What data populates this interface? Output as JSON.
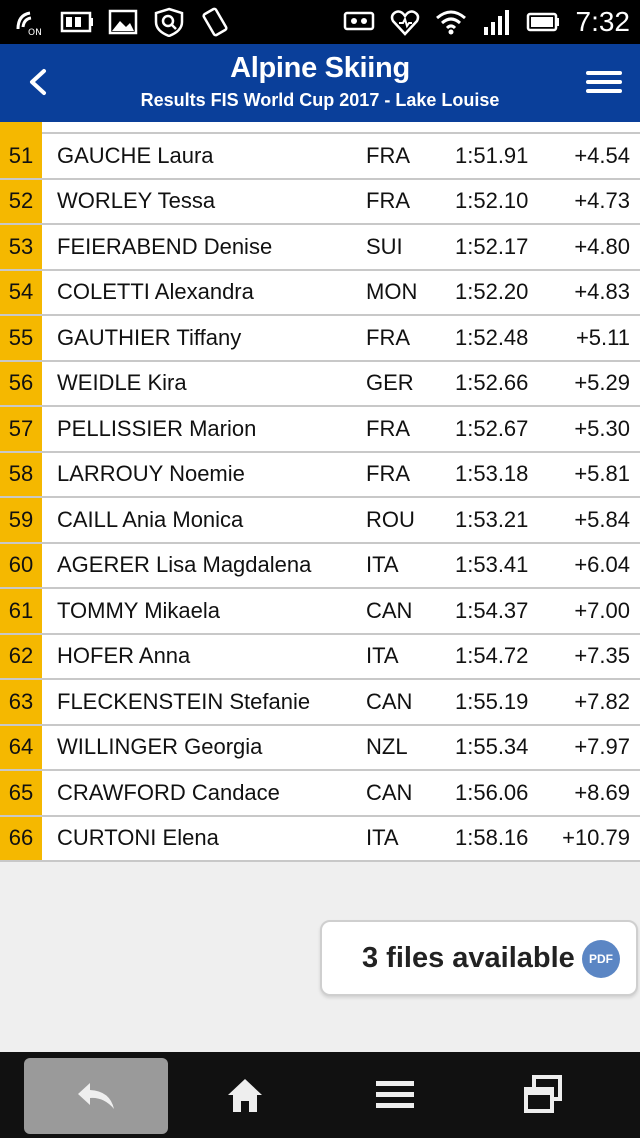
{
  "status_bar": {
    "time": "7:32",
    "left_icons": [
      "nfc-on-icon",
      "battery-saver-icon",
      "image-icon",
      "shield-search-icon",
      "rotate-icon"
    ],
    "right_icons": [
      "cast-icon",
      "heart-sync-icon",
      "wifi-icon",
      "signal-icon",
      "battery-icon"
    ],
    "nfc_label": "ON"
  },
  "header": {
    "title": "Alpine Skiing",
    "subtitle": "Results FIS World Cup 2017 - Lake Louise",
    "background": "#0a3f9a"
  },
  "results": {
    "accent_color": "#f5b800",
    "rows": [
      {
        "rank": "51",
        "name": "GAUCHE Laura",
        "nation": "FRA",
        "time": "1:51.91",
        "diff": "+4.54"
      },
      {
        "rank": "52",
        "name": "WORLEY Tessa",
        "nation": "FRA",
        "time": "1:52.10",
        "diff": "+4.73"
      },
      {
        "rank": "53",
        "name": "FEIERABEND Denise",
        "nation": "SUI",
        "time": "1:52.17",
        "diff": "+4.80"
      },
      {
        "rank": "54",
        "name": "COLETTI Alexandra",
        "nation": "MON",
        "time": "1:52.20",
        "diff": "+4.83"
      },
      {
        "rank": "55",
        "name": "GAUTHIER Tiffany",
        "nation": "FRA",
        "time": "1:52.48",
        "diff": "+5.11"
      },
      {
        "rank": "56",
        "name": "WEIDLE Kira",
        "nation": "GER",
        "time": "1:52.66",
        "diff": "+5.29"
      },
      {
        "rank": "57",
        "name": "PELLISSIER Marion",
        "nation": "FRA",
        "time": "1:52.67",
        "diff": "+5.30"
      },
      {
        "rank": "58",
        "name": "LARROUY Noemie",
        "nation": "FRA",
        "time": "1:53.18",
        "diff": "+5.81"
      },
      {
        "rank": "59",
        "name": "CAILL Ania Monica",
        "nation": "ROU",
        "time": "1:53.21",
        "diff": "+5.84"
      },
      {
        "rank": "60",
        "name": "AGERER Lisa Magdalena",
        "nation": "ITA",
        "time": "1:53.41",
        "diff": "+6.04"
      },
      {
        "rank": "61",
        "name": "TOMMY Mikaela",
        "nation": "CAN",
        "time": "1:54.37",
        "diff": "+7.00"
      },
      {
        "rank": "62",
        "name": "HOFER Anna",
        "nation": "ITA",
        "time": "1:54.72",
        "diff": "+7.35"
      },
      {
        "rank": "63",
        "name": "FLECKENSTEIN Stefanie",
        "nation": "CAN",
        "time": "1:55.19",
        "diff": "+7.82"
      },
      {
        "rank": "64",
        "name": "WILLINGER Georgia",
        "nation": "NZL",
        "time": "1:55.34",
        "diff": "+7.97"
      },
      {
        "rank": "65",
        "name": "CRAWFORD Candace",
        "nation": "CAN",
        "time": "1:56.06",
        "diff": "+8.69"
      },
      {
        "rank": "66",
        "name": "CURTONI Elena",
        "nation": "ITA",
        "time": "1:58.16",
        "diff": "+10.79"
      }
    ]
  },
  "files": {
    "label": "3 files available",
    "badge": "PDF"
  },
  "bottom_nav": {
    "items": [
      "back-icon",
      "home-icon",
      "menu-icon",
      "recent-apps-icon"
    ]
  }
}
